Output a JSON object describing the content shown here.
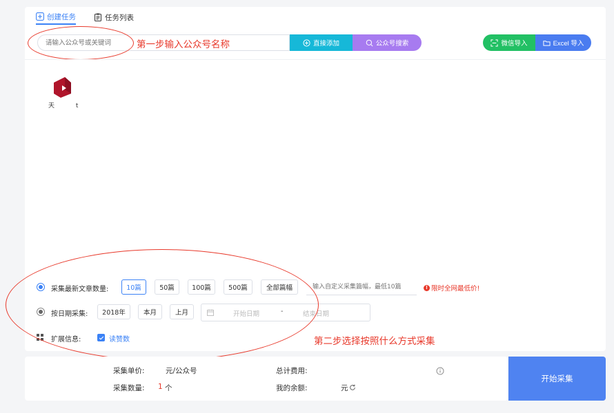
{
  "tabs": [
    {
      "label": "创建任务",
      "active": true
    },
    {
      "label": "任务列表",
      "active": false
    }
  ],
  "search": {
    "placeholder": "请输入公众号或关键词"
  },
  "buttons": {
    "direct_add": "直接添加",
    "account_search": "公众号搜索",
    "wechat_import": "微信导入",
    "excel_import": "Excel 导入",
    "start": "开始采集"
  },
  "annotations": {
    "step1": "第一步输入公众号名称",
    "step2": "第二步选择按照什么方式采集"
  },
  "account": {
    "name": "天 t"
  },
  "options": {
    "latest_label": "采集最新文章数量:",
    "count_chips": [
      "10篇",
      "50篇",
      "100篇",
      "500篇",
      "全部篇幅"
    ],
    "count_selected": "10篇",
    "custom_placeholder": "输入自定义采集篇幅，最低10篇",
    "promo": "限时全网最低价!",
    "promo_icon": "!",
    "date_label": "按日期采集:",
    "date_chips": [
      "2018年",
      "本月",
      "上月"
    ],
    "start_date": "开始日期",
    "range_sep": "-",
    "end_date": "结束日期",
    "extend_label": "扩展信息:",
    "read_count": "读赞数"
  },
  "summary": {
    "unit_price_label": "采集单价:",
    "unit_price_value": "元/公众号",
    "total_label": "总计费用:",
    "count_label": "采集数量:",
    "count_value": "1",
    "count_unit": "个",
    "balance_label": "我的余额:",
    "balance_value": "元"
  },
  "colors": {
    "accent": "#3b82f6",
    "direct_add": "#16b8d8",
    "search": "#a77bf0",
    "wechat": "#22c064",
    "excel": "#4a7cf0",
    "annotation": "#e8392b"
  }
}
